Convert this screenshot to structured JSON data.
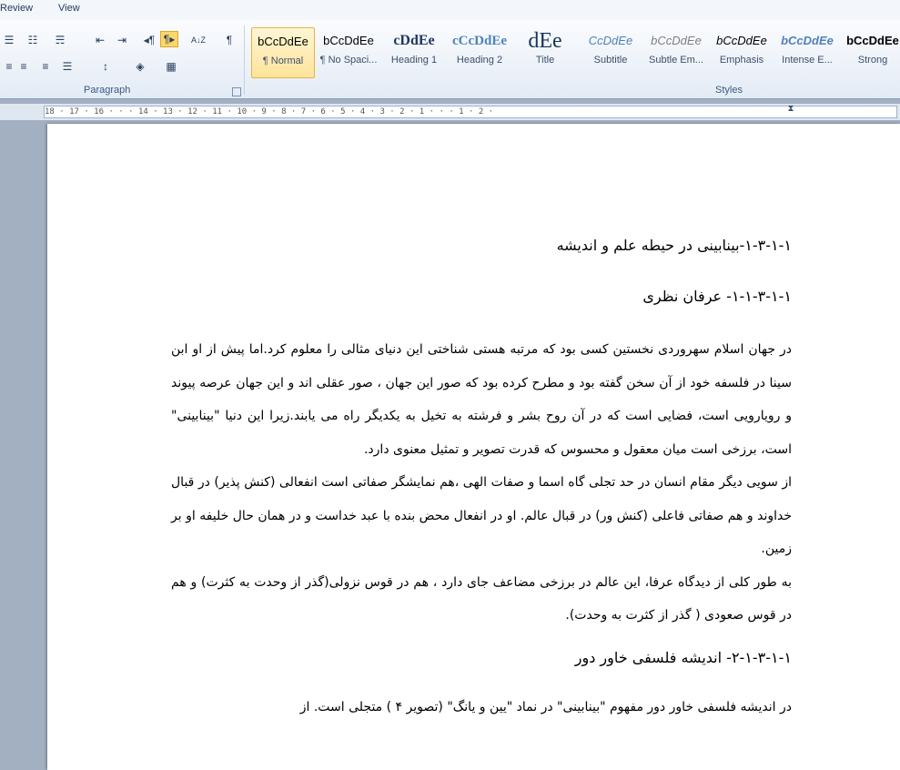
{
  "menu": {
    "tabs": [
      "Review",
      "View"
    ]
  },
  "ribbon": {
    "paragraph": {
      "label": "Paragraph",
      "row1": [
        "bullets-icon",
        "numbering-icon",
        "multilevel-list-icon",
        "decrease-indent-icon",
        "increase-indent-icon",
        "rtl-text-direction-icon",
        "ltr-text-direction-icon",
        "sort-icon",
        "show-formatting-marks-icon"
      ],
      "row2": [
        "align-left-icon",
        "align-center-icon",
        "align-right-icon",
        "justify-icon",
        "line-spacing-icon",
        "shading-icon",
        "borders-icon"
      ],
      "pilcrow": "¶",
      "sort_glyph": "A↓Z"
    },
    "styles": {
      "label": "Styles",
      "items": [
        {
          "preview": "bCcDdEe",
          "name": "¶ Normal",
          "selected": true
        },
        {
          "preview": "bCcDdEe",
          "name": "¶ No Spaci..."
        },
        {
          "preview": "cDdEe",
          "name": "Heading 1"
        },
        {
          "preview": "cCcDdEe",
          "name": "Heading 2"
        },
        {
          "preview": "dEe",
          "name": "Title"
        },
        {
          "preview": "CcDdEe",
          "name": "Subtitle"
        },
        {
          "preview": "bCcDdEe",
          "name": "Subtle Em..."
        },
        {
          "preview": "bCcDdEe",
          "name": "Emphasis"
        },
        {
          "preview": "bCcDdEe",
          "name": "Intense E..."
        },
        {
          "preview": "bCcDdEe",
          "name": "Strong"
        }
      ],
      "colors": {
        "heading": "#1f3864",
        "heading2": "#4f81bd",
        "subtitle": "#4f81bd",
        "subtle": "#808080"
      }
    }
  },
  "ruler": {
    "marks": "18 · 17 · 16 · · · 14 · 13 · 12 · 11 · 10 · 9 · 8 · 7 · 6 · 5 · 4 · 3 · 2 · 1 · · · 1 · 2 ·"
  },
  "document": {
    "heading1": "۱-۳-۱-۱-بینابینی در حیطه علم و اندیشه",
    "heading2": "۱-۱-۳-۱-۱- عرفان نظری",
    "para1": "در جهان اسلام سهروردی نخستین کسی بود که مرتبه هستی شناختی این دنیای مثالی را معلوم کرد.اما پیش از او ابن سینا در فلسفه خود از آن سخن گفته بود و مطرح کرده بود که صور این جهان ، صور عقلی اند و این جهان عرصه پیوند و رویارویی است، فضایی است که در آن روح بشر و فرشته به تخیل به یکدیگر راه می یابند.زیرا این دنیا \"بینابینی\" است، برزخی است میان معقول و محسوس که قدرت تصویر و تمثیل معنوی دارد.",
    "para2": "از سویی دیگر مقام انسان در حد تجلی گاه اسما و صفات الهی ،هم نمایشگر صفاتی است انفعالی (کنش پذیر) در قبال خداوند و هم صفاتی فاعلی (کنش ور) در قبال عالم. او در انفعال محض بنده با عبد خداست و در همان حال خلیفه او بر زمین.",
    "para3": "به طور کلی از دیدگاه عرفا، این عالم در برزخی مضاعف جای دارد ، هم در قوس نزولی(گذر از وحدت به کثرت) و هم در قوس صعودی ( گذر از کثرت به وحدت).",
    "heading3": "۲-۱-۳-۱-۱- اندیشه فلسفی خاور دور",
    "para4": "در اندیشه فلسفی خاور دور مفهوم \"بینابینی\" در نماد \"یین و یانگ\" (تصویر ۴ ) متجلی است. از"
  }
}
